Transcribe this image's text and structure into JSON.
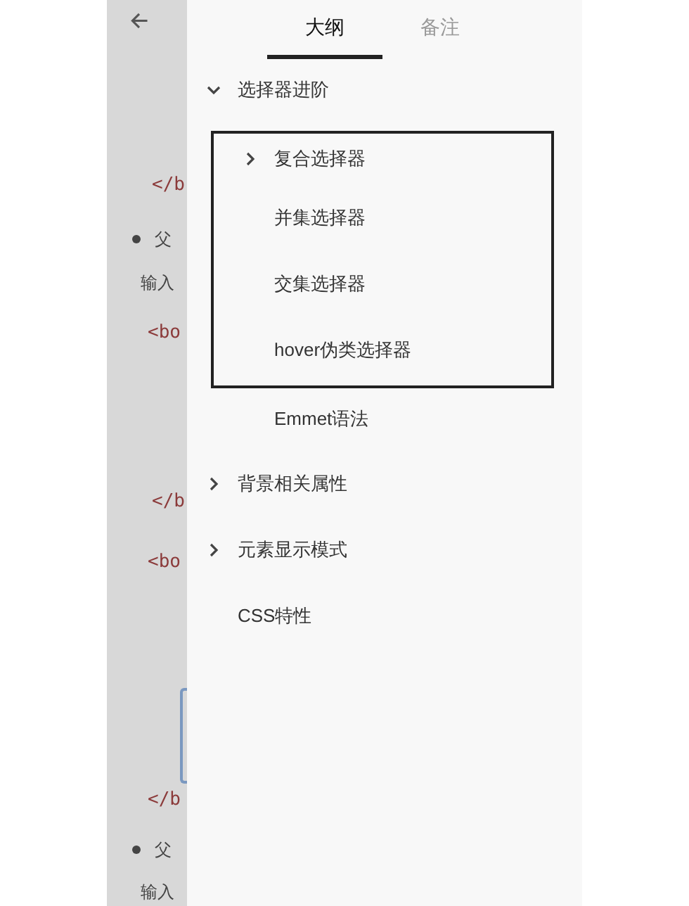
{
  "background_page": {
    "texts": [
      "</b",
      "父",
      "输入",
      "<bo",
      "</b",
      "<bo",
      "</b",
      "父",
      "输入"
    ]
  },
  "tabs": [
    {
      "label": "大纲",
      "selected": true
    },
    {
      "label": "备注",
      "selected": false
    }
  ],
  "outline": [
    {
      "label": "选择器进阶",
      "expanded": true,
      "children": [
        {
          "label": "复合选择器",
          "expanded": false,
          "boxed": true
        },
        {
          "label": "并集选择器",
          "boxed": true
        },
        {
          "label": "交集选择器",
          "boxed": true
        },
        {
          "label": "hover伪类选择器",
          "boxed": true
        },
        {
          "label": "Emmet语法",
          "boxed": false
        }
      ]
    },
    {
      "label": "背景相关属性",
      "expanded": false
    },
    {
      "label": "元素显示模式",
      "expanded": false
    },
    {
      "label": "CSS特性"
    }
  ]
}
